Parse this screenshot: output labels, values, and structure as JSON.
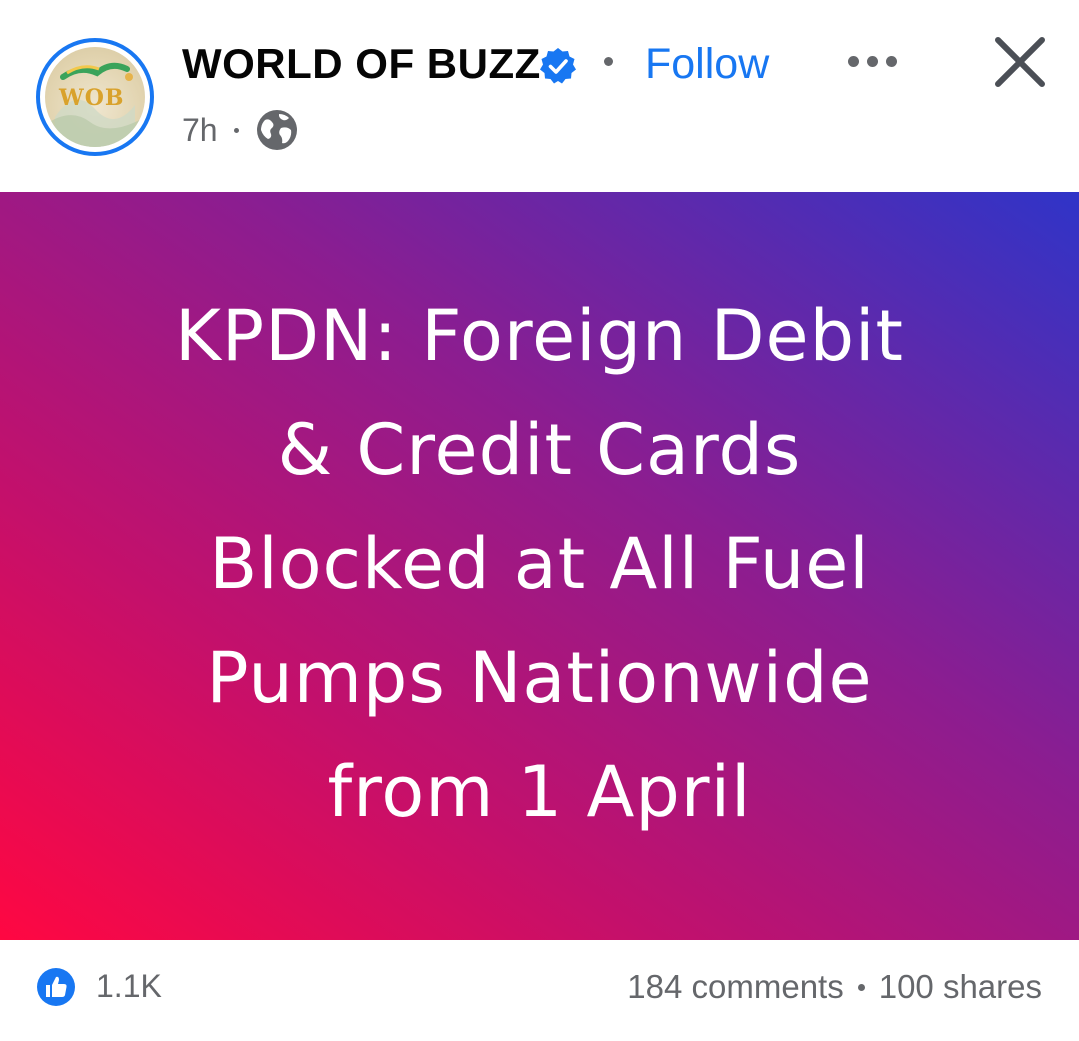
{
  "post": {
    "page_name": "WORLD OF BUZZ",
    "avatar_text": "WOB",
    "follow_label": "Follow",
    "time_ago": "7h",
    "audience_icon": "globe-icon",
    "verified_icon": "verified-badge-icon",
    "more_icon": "more-options-icon",
    "close_icon": "close-icon",
    "banner": {
      "lines": [
        "KPDN: Foreign Debit",
        "& Credit Cards",
        "Blocked at All Fuel",
        "Pumps Nationwide",
        "from 1 April"
      ]
    },
    "reactions": {
      "icon": "like-icon",
      "count": "1.1K"
    },
    "comments_label": "184 comments",
    "shares_label": "100 shares"
  },
  "colors": {
    "accent": "#1877f2",
    "text_primary": "#050505",
    "text_secondary": "#65676b",
    "gradient_start": "#ff0742",
    "gradient_end": "#2f34c8"
  }
}
